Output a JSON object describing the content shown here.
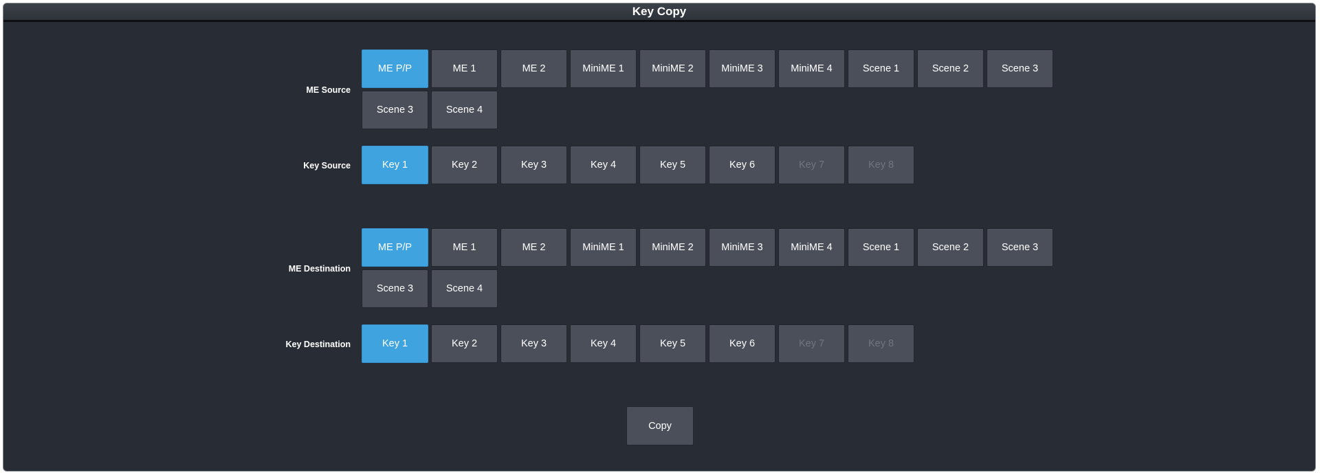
{
  "window": {
    "title": "Key Copy"
  },
  "me_source": {
    "label": "ME Source",
    "selected": 0,
    "buttons": [
      "ME P/P",
      "ME 1",
      "ME 2",
      "MiniME 1",
      "MiniME 2",
      "MiniME 3",
      "MiniME 4",
      "Scene 1",
      "Scene 2",
      "Scene 3",
      "Scene 3",
      "Scene 4"
    ]
  },
  "key_source": {
    "label": "Key Source",
    "selected": 0,
    "disabled": [
      6,
      7
    ],
    "buttons": [
      "Key 1",
      "Key 2",
      "Key 3",
      "Key 4",
      "Key 5",
      "Key 6",
      "Key 7",
      "Key 8"
    ]
  },
  "me_destination": {
    "label": "ME Destination",
    "selected": 0,
    "buttons": [
      "ME P/P",
      "ME 1",
      "ME 2",
      "MiniME 1",
      "MiniME 2",
      "MiniME 3",
      "MiniME 4",
      "Scene 1",
      "Scene 2",
      "Scene 3",
      "Scene 3",
      "Scene 4"
    ]
  },
  "key_destination": {
    "label": "Key Destination",
    "selected": 0,
    "disabled": [
      6,
      7
    ],
    "buttons": [
      "Key 1",
      "Key 2",
      "Key 3",
      "Key 4",
      "Key 5",
      "Key 6",
      "Key 7",
      "Key 8"
    ]
  },
  "actions": {
    "copy_label": "Copy"
  },
  "colors": {
    "background": "#282d35",
    "button": "#4a4f59",
    "selected": "#3fa3e0",
    "disabled_text": "#707580"
  }
}
